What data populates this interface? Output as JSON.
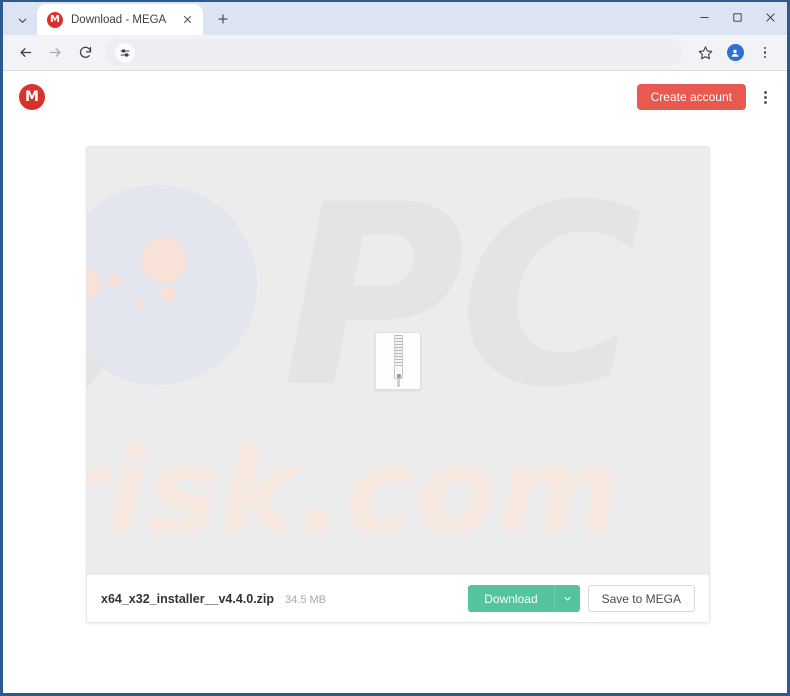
{
  "browser": {
    "tab_search_icon": "chevron-down-icon",
    "tabs": [
      {
        "title": "Download - MEGA",
        "favicon_letter": "M",
        "favicon_color": "#d9322c",
        "close_icon": "close-icon"
      }
    ],
    "new_tab_label": "+",
    "window_controls": {
      "minimize": "minimize-icon",
      "maximize": "maximize-icon",
      "close": "close-icon"
    },
    "toolbar": {
      "back_icon": "arrow-back-icon",
      "forward_icon": "arrow-forward-icon",
      "reload_icon": "reload-icon",
      "site_settings_icon": "tune-sliders-icon",
      "address_value": "",
      "address_placeholder": "",
      "bookmark_icon": "star-icon",
      "profile_icon": "profile-avatar-icon",
      "menu_icon": "three-dot-menu-icon"
    }
  },
  "site": {
    "logo_letter": "M",
    "logo_color": "#d9322c",
    "create_account_label": "Create account",
    "create_account_color": "#e8594f",
    "menu_icon": "three-dot-menu-icon"
  },
  "file_card": {
    "preview": {
      "watermark_pc": "PC",
      "watermark_risk": "risk.com",
      "file_type_icon": "zip-file-icon",
      "background_color": "#ececec"
    },
    "filename": "x64_x32_installer__v4.4.0.zip",
    "filesize": "34.5 MB",
    "download_label": "Download",
    "download_color": "#55c39c",
    "download_dropdown_icon": "chevron-down-icon",
    "save_label": "Save to MEGA"
  }
}
